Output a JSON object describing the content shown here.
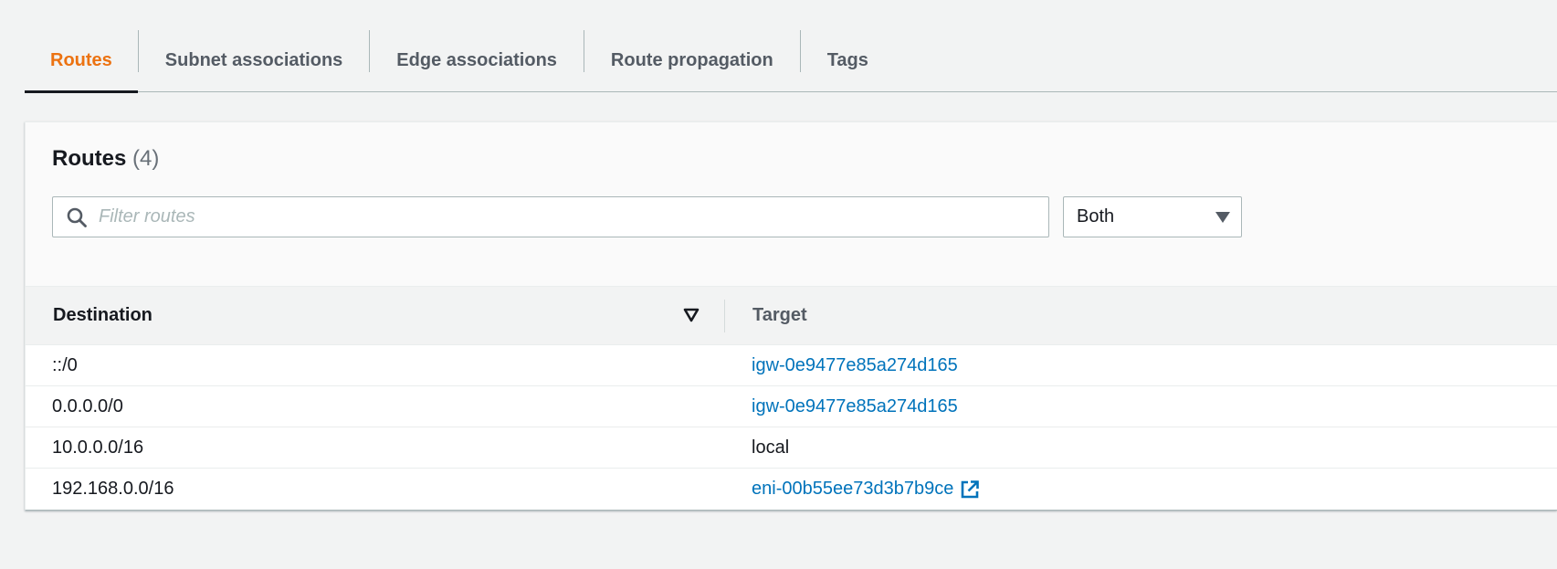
{
  "tabs": [
    {
      "label": "Routes",
      "active": true
    },
    {
      "label": "Subnet associations",
      "active": false
    },
    {
      "label": "Edge associations",
      "active": false
    },
    {
      "label": "Route propagation",
      "active": false
    },
    {
      "label": "Tags",
      "active": false
    }
  ],
  "routes_panel": {
    "title": "Routes",
    "count": "(4)",
    "filter": {
      "placeholder": "Filter routes",
      "value": "",
      "icon": "search-icon"
    },
    "ip_version_select": {
      "value": "Both",
      "icon": "caret-down-icon"
    },
    "table": {
      "columns": {
        "destination": "Destination",
        "target": "Target"
      },
      "sort_icon": "sort-descending-icon",
      "rows": [
        {
          "destination": "::/0",
          "target": "igw-0e9477e85a274d165",
          "target_is_link": true,
          "external": false
        },
        {
          "destination": "0.0.0.0/0",
          "target": "igw-0e9477e85a274d165",
          "target_is_link": true,
          "external": false
        },
        {
          "destination": "10.0.0.0/16",
          "target": "local",
          "target_is_link": false,
          "external": false
        },
        {
          "destination": "192.168.0.0/16",
          "target": "eni-00b55ee73d3b7b9ce",
          "target_is_link": true,
          "external": true
        }
      ]
    }
  },
  "colors": {
    "accent_tab": "#ec7211",
    "link": "#0073bb",
    "background": "#f2f3f3",
    "text": "#16191f"
  }
}
